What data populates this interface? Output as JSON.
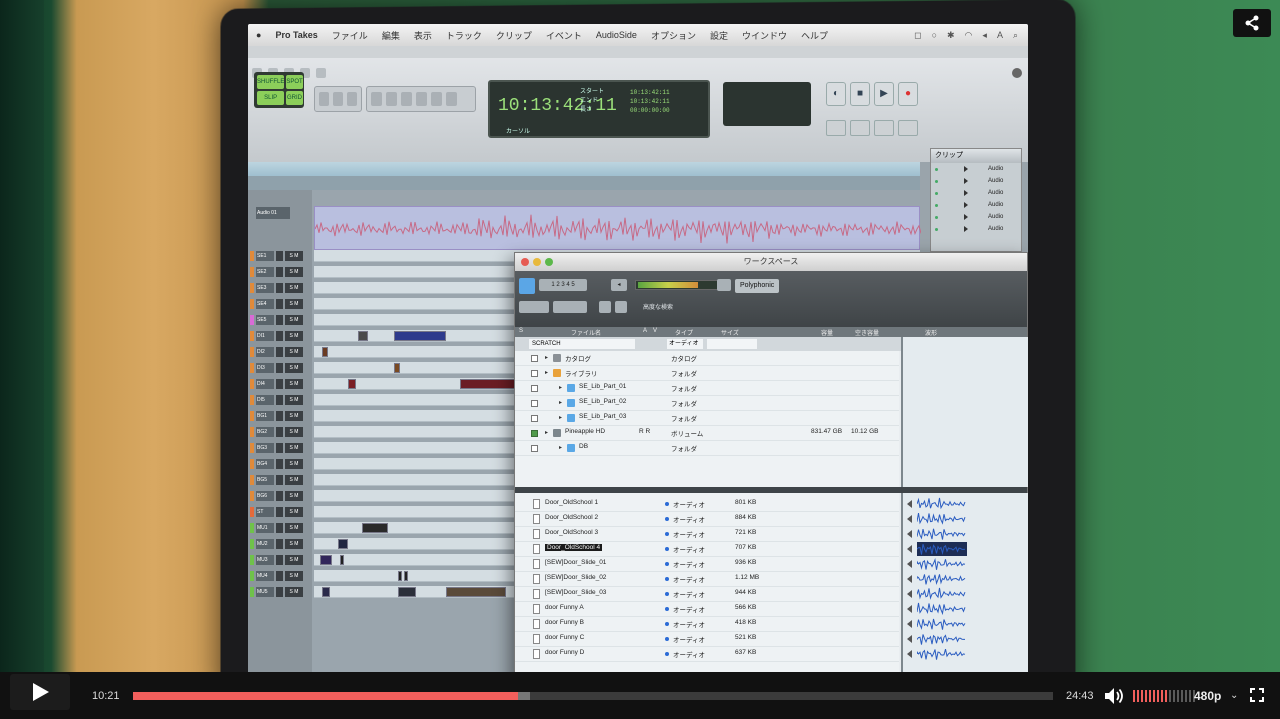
{
  "player": {
    "current_time": "10:21",
    "total_time": "24:43",
    "progress_fraction": 0.419,
    "buffered_fraction": 0.432,
    "volume_fraction": 0.55,
    "quality": "480p",
    "accent": "#f25f5c"
  },
  "icons": {
    "play": "play-icon",
    "share": "share-icon",
    "volume": "volume-icon",
    "fullscreen": "fullscreen-icon",
    "quality_caret": "chevron-down-icon"
  },
  "menubar": {
    "app": "Pro Takes",
    "items": [
      "ファイル",
      "編集",
      "表示",
      "トラック",
      "クリップ",
      "イベント",
      "AudioSide",
      "オプション",
      "設定",
      "ウインドウ",
      "ヘルプ"
    ]
  },
  "transport": {
    "edit_modes": [
      "SHUFFLE",
      "SPOT",
      "SLIP",
      "GRID"
    ],
    "main_counter": "10:13:42:11",
    "counter_labels": [
      "スタート",
      "エンド",
      "長さ"
    ],
    "counter_values": [
      "10:13:42:11",
      "10:13:42:11",
      "00:00:00:00"
    ],
    "cursor_label": "カーソル"
  },
  "clips_panel": {
    "title": "クリップ",
    "rows": [
      "Audio",
      "Audio",
      "Audio",
      "Audio",
      "Audio",
      "Audio"
    ]
  },
  "workspace": {
    "title": "ワークスペース",
    "polyphonic": "Polyphonic",
    "advanced_search": "高度な検索",
    "columns": [
      "ファイル名",
      "A",
      "V",
      "タイプ",
      "サイズ",
      "容量",
      "空き容量",
      "波形"
    ],
    "filter_name": "SCRATCH",
    "filter_kind": "オーディオ",
    "volumes": [
      {
        "name": "カタログ",
        "kind": "カタログ",
        "rw": "",
        "capacity": "",
        "free": "",
        "checked": false,
        "indent": 0,
        "icon": "catalog"
      },
      {
        "name": "ライブラリ",
        "kind": "フォルダ",
        "rw": "",
        "capacity": "",
        "free": "",
        "checked": false,
        "indent": 0,
        "icon": "folder-orange"
      },
      {
        "name": "SE_Lib_Part_01",
        "kind": "フォルダ",
        "rw": "",
        "capacity": "",
        "free": "",
        "checked": false,
        "indent": 1,
        "icon": "folder"
      },
      {
        "name": "SE_Lib_Part_02",
        "kind": "フォルダ",
        "rw": "",
        "capacity": "",
        "free": "",
        "checked": false,
        "indent": 1,
        "icon": "folder"
      },
      {
        "name": "SE_Lib_Part_03",
        "kind": "フォルダ",
        "rw": "",
        "capacity": "",
        "free": "",
        "checked": false,
        "indent": 1,
        "icon": "folder"
      },
      {
        "name": "Pineapple HD",
        "kind": "ボリューム",
        "rw": "R  R",
        "capacity": "831.47 GB",
        "free": "10.12 GB",
        "checked": true,
        "indent": 0,
        "icon": "drive"
      },
      {
        "name": "DB",
        "kind": "フォルダ",
        "rw": "",
        "capacity": "",
        "free": "",
        "checked": false,
        "indent": 1,
        "icon": "folder"
      }
    ],
    "files": [
      {
        "name": "Door_OldSchool 1",
        "kind": "オーディオ",
        "size": "801 KB"
      },
      {
        "name": "Door_OldSchool 2",
        "kind": "オーディオ",
        "size": "884 KB"
      },
      {
        "name": "Door_OldSchool 3",
        "kind": "オーディオ",
        "size": "721 KB"
      },
      {
        "name": "Door_OldSchool 4",
        "kind": "オーディオ",
        "size": "707 KB",
        "selected": true
      },
      {
        "name": "[SEW]Door_Slide_01",
        "kind": "オーディオ",
        "size": "936 KB"
      },
      {
        "name": "[SEW]Door_Slide_02",
        "kind": "オーディオ",
        "size": "1.12 MB"
      },
      {
        "name": "[SEW]Door_Slide_03",
        "kind": "オーディオ",
        "size": "944 KB"
      },
      {
        "name": "door Funny A",
        "kind": "オーディオ",
        "size": "566 KB"
      },
      {
        "name": "door Funny B",
        "kind": "オーディオ",
        "size": "418 KB"
      },
      {
        "name": "door Funny C",
        "kind": "オーディオ",
        "size": "521 KB"
      },
      {
        "name": "door Funny D",
        "kind": "オーディオ",
        "size": "637 KB"
      }
    ]
  },
  "tracks": {
    "audio_track": "Audio 01",
    "headers": [
      "SE1",
      "SE2",
      "SE3",
      "SE4",
      "SE5",
      "DI1",
      "DI2",
      "DI3",
      "DI4",
      "DI5",
      "BG1",
      "BG2",
      "BG3",
      "BG4",
      "BG5",
      "BG6",
      "ST",
      "MU1",
      "MU2",
      "MU3",
      "MU4",
      "MU5"
    ]
  }
}
